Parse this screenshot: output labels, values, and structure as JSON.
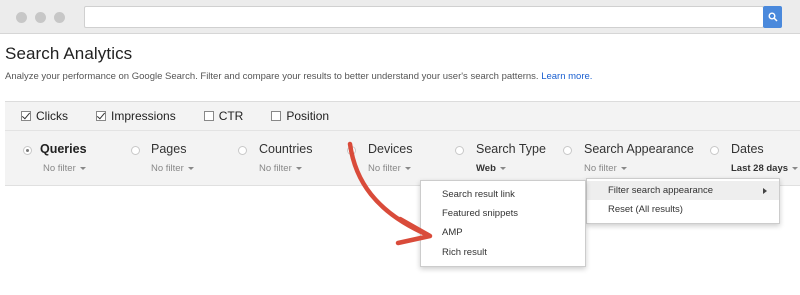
{
  "browser": {
    "url": "",
    "search_icon": "search-icon"
  },
  "header": {
    "title": "Search Analytics",
    "subtitle": "Analyze your performance on Google Search. Filter and compare your results to better understand your user's search patterns.",
    "learn_more": "Learn more."
  },
  "metrics": [
    {
      "label": "Clicks",
      "checked": true
    },
    {
      "label": "Impressions",
      "checked": true
    },
    {
      "label": "CTR",
      "checked": false
    },
    {
      "label": "Position",
      "checked": false
    }
  ],
  "dimensions": [
    {
      "label": "Queries",
      "filter": "No filter",
      "selected": true
    },
    {
      "label": "Pages",
      "filter": "No filter",
      "selected": false
    },
    {
      "label": "Countries",
      "filter": "No filter",
      "selected": false
    },
    {
      "label": "Devices",
      "filter": "No filter",
      "selected": false
    },
    {
      "label": "Search Type",
      "filter": "Web",
      "selected": false
    },
    {
      "label": "Search Appearance",
      "filter": "No filter",
      "selected": false
    },
    {
      "label": "Dates",
      "filter": "Last 28 days",
      "selected": false
    }
  ],
  "appearance_menu": {
    "items": [
      "Filter search appearance",
      "Reset (All results)"
    ]
  },
  "appearance_submenu": {
    "items": [
      "Search result link",
      "Featured snippets",
      "AMP",
      "Rich result"
    ]
  },
  "colors": {
    "accent": "#4a89dc",
    "link": "#1a5fd0",
    "annotation_arrow": "#d94b3a",
    "bar_background": "#f3f3f3"
  }
}
